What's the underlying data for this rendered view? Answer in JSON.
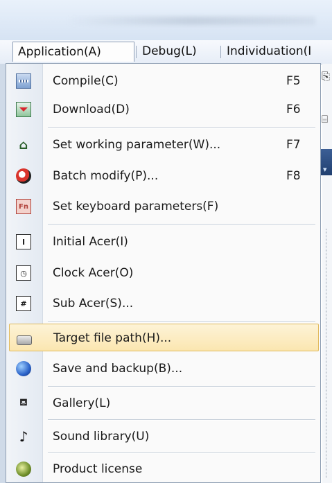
{
  "menubar": {
    "items": [
      {
        "label": "Application(A)",
        "active": true
      },
      {
        "label": "Debug(L)",
        "active": false
      },
      {
        "label": "Individuation(I",
        "active": false
      }
    ]
  },
  "dropdown": {
    "items": [
      {
        "label": "Compile(C)",
        "shortcut": "F5",
        "icon": "compile-icon"
      },
      {
        "label": "Download(D)",
        "shortcut": "F6",
        "icon": "download-icon"
      },
      {
        "label": "Set working parameter(W)...",
        "shortcut": "F7",
        "icon": "house-icon"
      },
      {
        "label": "Batch modify(P)...",
        "shortcut": "F8",
        "icon": "batch-modify-icon"
      },
      {
        "label": "Set keyboard parameters(F)",
        "shortcut": "",
        "icon": "fn-key-icon"
      },
      {
        "label": "Initial Acer(I)",
        "shortcut": "",
        "icon": "initial-icon"
      },
      {
        "label": "Clock Acer(O)",
        "shortcut": "",
        "icon": "clock-icon"
      },
      {
        "label": "Sub Acer(S)...",
        "shortcut": "",
        "icon": "sub-icon"
      },
      {
        "label": "Target file path(H)...",
        "shortcut": "",
        "icon": "drive-icon",
        "highlighted": true
      },
      {
        "label": "Save and backup(B)...",
        "shortcut": "",
        "icon": "globe-icon"
      },
      {
        "label": "Gallery(L)",
        "shortcut": "",
        "icon": "gallery-icon"
      },
      {
        "label": "Sound library(U)",
        "shortcut": "",
        "icon": "music-note-icon"
      },
      {
        "label": "Product license",
        "shortcut": "",
        "icon": "license-icon"
      }
    ]
  },
  "colors": {
    "highlight_bg": "#fbe6b0",
    "highlight_border": "#e0b95c",
    "menu_border": "#8d9db2"
  }
}
